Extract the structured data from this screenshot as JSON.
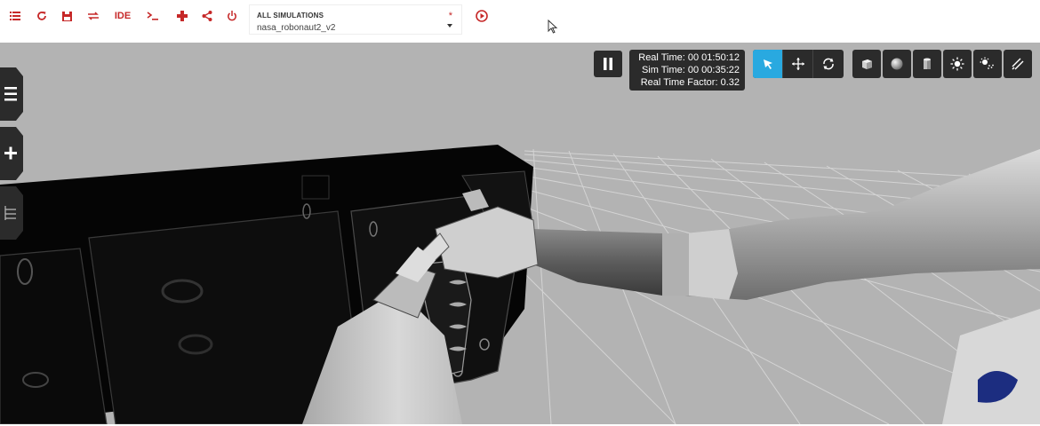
{
  "toolbar": {
    "icons": [
      "list-icon",
      "refresh-icon",
      "save-icon",
      "swap-icon",
      "ide-button",
      "terminal-icon",
      "plugin-icon",
      "share-icon",
      "power-icon",
      "record-icon"
    ],
    "ide_label": "IDE",
    "accent_color": "#c62828"
  },
  "simulation": {
    "label": "ALL SIMULATIONS",
    "value": "nasa_robonaut2_v2",
    "modified_marker": "*"
  },
  "stats": {
    "real_time": "Real Time: 00 01:50:12",
    "sim_time": "Sim Time: 00 00:35:22",
    "real_time_factor": "Real Time Factor: 0.32"
  },
  "tools": {
    "active_tool": "select",
    "active_color": "#29a9e0",
    "items": [
      "select-icon",
      "translate-icon",
      "rotate-icon"
    ]
  },
  "shapes": [
    "box-icon",
    "sphere-icon",
    "cylinder-icon",
    "sun-light-icon",
    "spot-light-icon",
    "directional-light-icon"
  ],
  "side_tabs": [
    "menu-icon",
    "add-icon",
    "tree-icon"
  ]
}
